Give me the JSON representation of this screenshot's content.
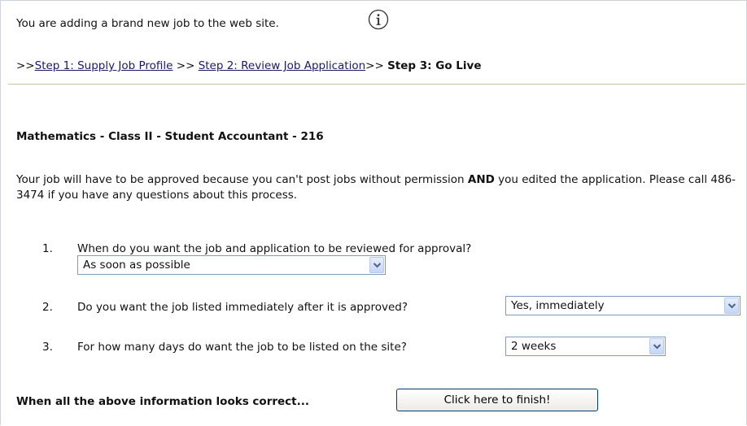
{
  "header": {
    "intro": "You are adding a brand new job to the web site.",
    "info_icon": "info-icon",
    "steps": {
      "prefix": ">>",
      "step1": "Step 1: Supply Job Profile",
      "sep1": " >> ",
      "step2": "Step 2: Review Job Application",
      "sep2": ">> ",
      "step3": "Step 3: Go Live"
    }
  },
  "job": {
    "title": "Mathematics - Class II - Student Accountant - 216"
  },
  "approval": {
    "before": "Your job will have to be approved because you can't post jobs without permission ",
    "emphasis": "AND",
    "after": " you edited the application. Please call 486-3474 if you have any questions about this process."
  },
  "questions": [
    {
      "number": "1.",
      "text": "When do you want the job and application to be reviewed for approval?",
      "selected": "As soon as possible"
    },
    {
      "number": "2.",
      "text": "Do you want the job listed immediately after it is approved?",
      "selected": "Yes, immediately"
    },
    {
      "number": "3.",
      "text": "For how many days do want the job to be listed on the site?",
      "selected": "2 weeks"
    }
  ],
  "footer": {
    "prompt": "When all the above information looks correct...",
    "finish_label": "Click here to finish!"
  },
  "colors": {
    "link": "#1a1a66",
    "divider": "#c9c19a",
    "select_border": "#7f9db9",
    "button_border": "#003c74"
  }
}
